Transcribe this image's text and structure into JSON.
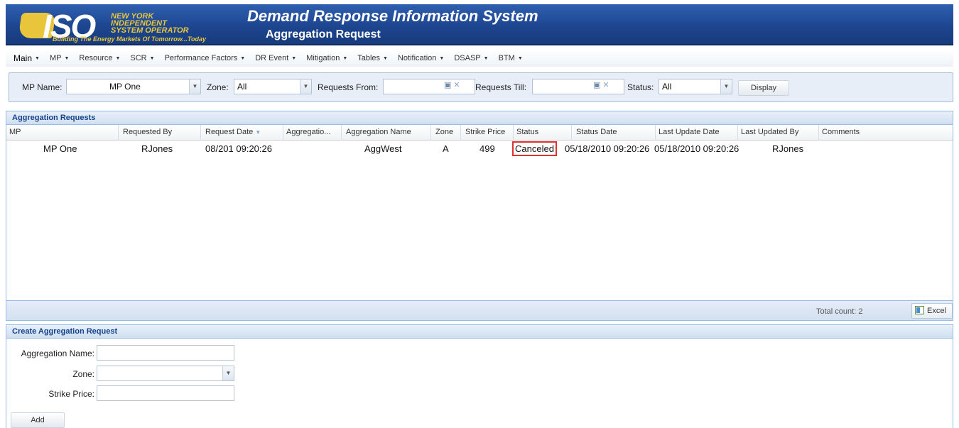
{
  "header": {
    "logo_text": "ISO",
    "org_line1": "NEW YORK",
    "org_line2": "INDEPENDENT",
    "org_line3": "SYSTEM OPERATOR",
    "tagline": "Building The Energy Markets Of Tomorrow...Today",
    "app_title": "Demand Response Information System",
    "page_title": "Aggregation Request"
  },
  "menu": {
    "items": [
      {
        "label": "Main"
      },
      {
        "label": "MP"
      },
      {
        "label": "Resource"
      },
      {
        "label": "SCR"
      },
      {
        "label": "Performance Factors"
      },
      {
        "label": "DR Event"
      },
      {
        "label": "Mitigation"
      },
      {
        "label": "Tables"
      },
      {
        "label": "Notification"
      },
      {
        "label": "DSASP"
      },
      {
        "label": "BTM"
      }
    ]
  },
  "filters": {
    "mp_name_label": "MP Name:",
    "mp_name_value": "MP One",
    "zone_label": "Zone:",
    "zone_value": "All",
    "requests_from_label": "Requests From:",
    "requests_from_value": "",
    "requests_till_label": "Requests Till:",
    "requests_till_value": "",
    "status_label": "Status:",
    "status_value": "All",
    "display_button": "Display"
  },
  "grid": {
    "title": "Aggregation Requests",
    "columns": [
      "MP",
      "Requested By",
      "Request Date",
      "Aggregatio...",
      "Aggregation Name",
      "Zone",
      "Strike Price",
      "Status",
      "Status Date",
      "Last Update Date",
      "Last Updated By",
      "Comments"
    ],
    "rows": [
      {
        "mp": "MP One",
        "requested_by": "RJones",
        "request_date": "08/201 09:20:26",
        "aggregation_id": "",
        "aggregation_name": "AggWest",
        "zone": "A",
        "strike_price": "499",
        "status": "Canceled",
        "status_date": "05/18/2010 09:20:26",
        "last_update_date": "05/18/2010 09:20:26",
        "last_updated_by": "RJones",
        "comments": ""
      }
    ],
    "total_count": "Total count: 2",
    "excel_button": "Excel"
  },
  "create_form": {
    "title": "Create Aggregation Request",
    "aggregation_name_label": "Aggregation Name:",
    "aggregation_name_value": "",
    "zone_label": "Zone:",
    "zone_value": "",
    "strike_price_label": "Strike Price:",
    "strike_price_value": "",
    "add_button": "Add"
  },
  "colors": {
    "banner": "#1d4690",
    "accent_gold": "#e8c53a",
    "panel_header_text": "#15428b",
    "highlight_border": "#e03030"
  }
}
